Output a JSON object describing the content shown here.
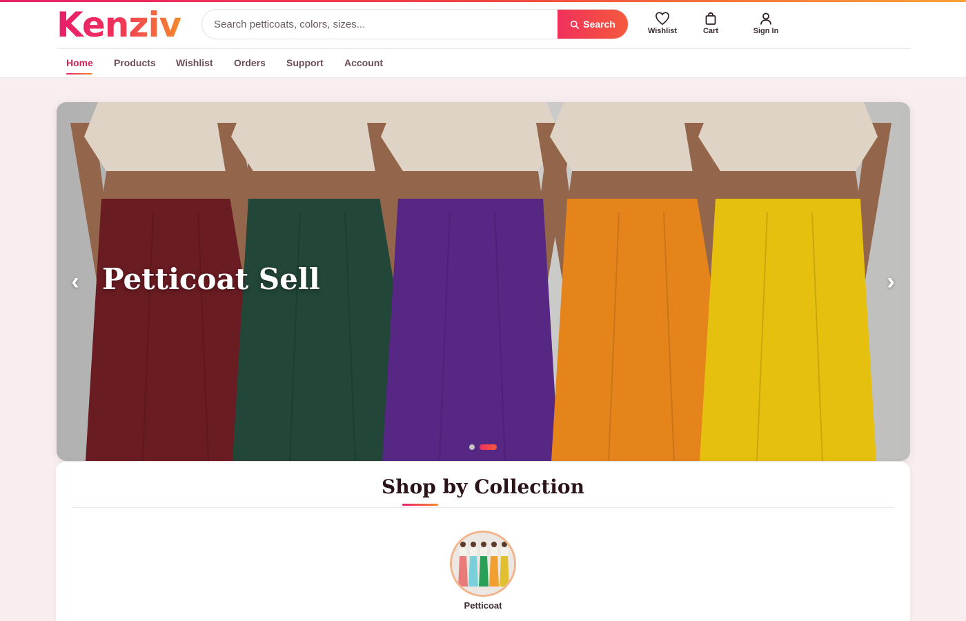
{
  "brand": {
    "logo_text": "Kenziv",
    "accent": "#e8206a",
    "accent_end": "#f58a2e"
  },
  "search": {
    "placeholder": "Search petticoats, colors, sizes...",
    "button_label": "Search",
    "button_icon": "search-icon"
  },
  "header_actions": [
    {
      "label": "Wishlist",
      "icon": "heart-icon"
    },
    {
      "label": "Cart",
      "icon": "shopping-bag-icon"
    },
    {
      "label": "Sign In",
      "icon": "user-icon"
    }
  ],
  "nav": {
    "items": [
      {
        "label": "Home",
        "active": true
      },
      {
        "label": "Products",
        "active": false
      },
      {
        "label": "Wishlist",
        "active": false
      },
      {
        "label": "Orders",
        "active": false
      },
      {
        "label": "Support",
        "active": false
      },
      {
        "label": "Account",
        "active": false
      }
    ]
  },
  "hero": {
    "title": "Petticoat Sell",
    "prev_icon": "chevron-left-icon",
    "next_icon": "chevron-right-icon",
    "prev_glyph": "‹",
    "next_glyph": "›",
    "slides_total": 2,
    "active_slide": 2,
    "skirt_colors": [
      "#6e1e24",
      "#24493a",
      "#5a2a8a",
      "#f08a1e",
      "#f0c810"
    ],
    "top_color": "#e8dccc",
    "skin_color": "#9a6a4e"
  },
  "collection": {
    "title": "Shop by Collection",
    "items": [
      {
        "label": "Petticoat",
        "skirt_colors": [
          "#e87a7a",
          "#7ad0d8",
          "#28a058",
          "#f0a030",
          "#e0c030"
        ]
      }
    ]
  }
}
